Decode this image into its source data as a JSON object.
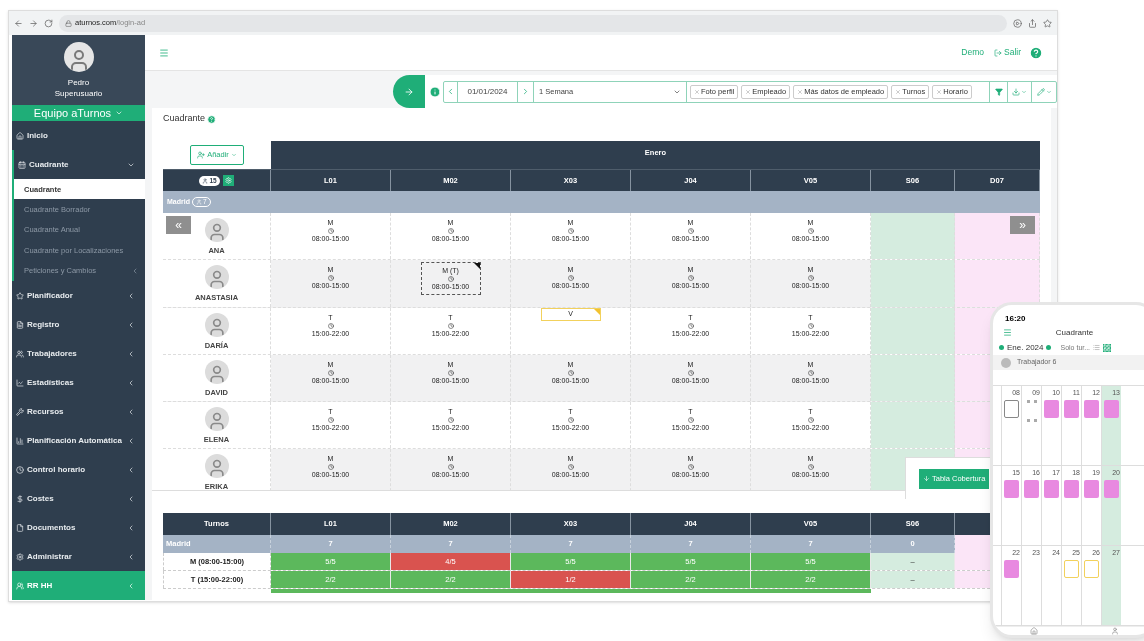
{
  "browser": {
    "host": "aturnos.com",
    "path": "/login-ad"
  },
  "sidebar": {
    "user": {
      "name": "Pedro",
      "role": "Superusuario"
    },
    "team": "Equipo aTurnos",
    "items": [
      {
        "label": "Inicio",
        "selected": false
      },
      {
        "label": "Cuadrante",
        "selected": false,
        "expanded": true,
        "children": [
          {
            "label": "Cuadrante",
            "selected": true
          },
          {
            "label": "Cuadrante Borrador",
            "selected": false
          },
          {
            "label": "Cuadrante Anual",
            "selected": false
          },
          {
            "label": "Cuadrante por Localizaciones",
            "selected": false
          },
          {
            "label": "Peticiones y Cambios",
            "selected": false,
            "expanded": false
          }
        ]
      },
      {
        "label": "Planificador",
        "selected": false,
        "expanded": false
      },
      {
        "label": "Registro",
        "selected": false,
        "expanded": false
      },
      {
        "label": "Trabajadores",
        "selected": false,
        "expanded": false
      },
      {
        "label": "Estadísticas",
        "selected": false,
        "expanded": false
      },
      {
        "label": "Recursos",
        "selected": false,
        "expanded": false
      },
      {
        "label": "Planificación Automática",
        "selected": false,
        "expanded": false
      },
      {
        "label": "Control horario",
        "selected": false,
        "expanded": false
      },
      {
        "label": "Costes",
        "selected": false,
        "expanded": false
      },
      {
        "label": "Documentos",
        "selected": false,
        "expanded": false
      },
      {
        "label": "Administrar",
        "selected": false,
        "expanded": false
      },
      {
        "label": "RR HH",
        "selected": true,
        "expanded": false
      }
    ]
  },
  "topbar": {
    "links": [
      "Demo",
      "Salir"
    ]
  },
  "toolbar": {
    "date": "01/01/2024",
    "range": "1 Semana",
    "chips": [
      "Foto perfil",
      "Empleado",
      "Más datos de empleado",
      "Turnos",
      "Horario"
    ]
  },
  "page_title": "Cuadrante",
  "grid": {
    "add_button": "Añadir",
    "month": "Enero",
    "staff_count": "15",
    "days": [
      {
        "label": "L01",
        "kind": "weekday"
      },
      {
        "label": "M02",
        "kind": "weekday"
      },
      {
        "label": "X03",
        "kind": "weekday"
      },
      {
        "label": "J04",
        "kind": "weekday"
      },
      {
        "label": "V05",
        "kind": "weekday"
      },
      {
        "label": "S06",
        "kind": "saturday"
      },
      {
        "label": "D07",
        "kind": "sunday"
      }
    ],
    "group": {
      "name": "Madrid",
      "count": "7"
    },
    "nav_prev": "«",
    "nav_next": "»",
    "employees": [
      {
        "name": "ANA",
        "shifts": [
          {
            "code": "M",
            "time": "08:00-15:00",
            "kind": "normal"
          },
          {
            "code": "M",
            "time": "08:00-15:00",
            "kind": "normal"
          },
          {
            "code": "M",
            "time": "08:00-15:00",
            "kind": "normal"
          },
          {
            "code": "M",
            "time": "08:00-15:00",
            "kind": "normal"
          },
          {
            "code": "M",
            "time": "08:00-15:00",
            "kind": "normal"
          }
        ]
      },
      {
        "name": "ANASTASIA",
        "shifts": [
          {
            "code": "M",
            "time": "08:00-15:00",
            "kind": "normal"
          },
          {
            "code": "M (T)",
            "time": "08:00-15:00",
            "kind": "changed"
          },
          {
            "code": "M",
            "time": "08:00-15:00",
            "kind": "normal"
          },
          {
            "code": "M",
            "time": "08:00-15:00",
            "kind": "normal"
          },
          {
            "code": "M",
            "time": "08:00-15:00",
            "kind": "normal"
          }
        ]
      },
      {
        "name": "DARÍA",
        "shifts": [
          {
            "code": "T",
            "time": "15:00-22:00",
            "kind": "normal"
          },
          {
            "code": "T",
            "time": "15:00-22:00",
            "kind": "normal"
          },
          {
            "code": "V",
            "kind": "vacation"
          },
          {
            "code": "T",
            "time": "15:00-22:00",
            "kind": "normal"
          },
          {
            "code": "T",
            "time": "15:00-22:00",
            "kind": "normal"
          }
        ]
      },
      {
        "name": "DAVID",
        "shifts": [
          {
            "code": "M",
            "time": "08:00-15:00",
            "kind": "normal"
          },
          {
            "code": "M",
            "time": "08:00-15:00",
            "kind": "normal"
          },
          {
            "code": "M",
            "time": "08:00-15:00",
            "kind": "normal"
          },
          {
            "code": "M",
            "time": "08:00-15:00",
            "kind": "normal"
          },
          {
            "code": "M",
            "time": "08:00-15:00",
            "kind": "normal"
          }
        ]
      },
      {
        "name": "ELENA",
        "shifts": [
          {
            "code": "T",
            "time": "15:00-22:00",
            "kind": "normal"
          },
          {
            "code": "T",
            "time": "15:00-22:00",
            "kind": "normal"
          },
          {
            "code": "T",
            "time": "15:00-22:00",
            "kind": "normal"
          },
          {
            "code": "T",
            "time": "15:00-22:00",
            "kind": "normal"
          },
          {
            "code": "T",
            "time": "15:00-22:00",
            "kind": "normal"
          }
        ]
      },
      {
        "name": "ERIKA",
        "shifts": [
          {
            "code": "M",
            "time": "08:00-15:00",
            "kind": "normal"
          },
          {
            "code": "M",
            "time": "08:00-15:00",
            "kind": "normal"
          },
          {
            "code": "M",
            "time": "08:00-15:00",
            "kind": "normal"
          },
          {
            "code": "M",
            "time": "08:00-15:00",
            "kind": "normal"
          },
          {
            "code": "M",
            "time": "08:00-15:00",
            "kind": "normal"
          }
        ]
      }
    ]
  },
  "coverage": {
    "button": "Tabla Cobertura",
    "title": "Turnos",
    "columns": [
      "L01",
      "M02",
      "X03",
      "J04",
      "V05",
      "S06"
    ],
    "group": {
      "name": "Madrid",
      "counts": [
        "7",
        "7",
        "7",
        "7",
        "7",
        "0"
      ]
    },
    "rows": [
      {
        "label": "M (08:00-15:00)",
        "cells": [
          {
            "value": "5/5",
            "kind": "ok"
          },
          {
            "value": "4/5",
            "kind": "short"
          },
          {
            "value": "5/5",
            "kind": "ok"
          },
          {
            "value": "5/5",
            "kind": "ok"
          },
          {
            "value": "5/5",
            "kind": "ok"
          },
          {
            "value": "–",
            "kind": "none"
          }
        ]
      },
      {
        "label": "T (15:00-22:00)",
        "cells": [
          {
            "value": "2/2",
            "kind": "ok"
          },
          {
            "value": "2/2",
            "kind": "ok"
          },
          {
            "value": "1/2",
            "kind": "short"
          },
          {
            "value": "2/2",
            "kind": "ok"
          },
          {
            "value": "2/2",
            "kind": "ok"
          },
          {
            "value": "–",
            "kind": "none"
          }
        ]
      }
    ]
  },
  "phone": {
    "time": "16:20",
    "title": "Cuadrante",
    "month": "Ene. 2024",
    "filter": "Solo tur...",
    "worker": "Trabajador 6",
    "weeks": [
      [
        {
          "num": "08",
          "kind": "outline",
          "weekend": false
        },
        {
          "num": "09",
          "kind": "plain",
          "weekend": false
        },
        {
          "num": "10",
          "kind": "pink",
          "weekend": false
        },
        {
          "num": "11",
          "kind": "pink",
          "weekend": false
        },
        {
          "num": "12",
          "kind": "pink",
          "weekend": false
        },
        {
          "num": "13",
          "kind": "pink",
          "weekend": true
        }
      ],
      [
        {
          "num": "15",
          "kind": "pink",
          "weekend": false
        },
        {
          "num": "16",
          "kind": "pink",
          "weekend": false
        },
        {
          "num": "17",
          "kind": "pink",
          "weekend": false
        },
        {
          "num": "18",
          "kind": "pink",
          "weekend": false
        },
        {
          "num": "19",
          "kind": "pink",
          "weekend": false
        },
        {
          "num": "20",
          "kind": "pink",
          "weekend": true
        }
      ],
      [
        {
          "num": "22",
          "kind": "pink",
          "weekend": false
        },
        {
          "num": "23",
          "kind": "none",
          "weekend": false
        },
        {
          "num": "24",
          "kind": "none",
          "weekend": false
        },
        {
          "num": "25",
          "kind": "yellow",
          "weekend": false
        },
        {
          "num": "26",
          "kind": "yellow",
          "weekend": false
        },
        {
          "num": "27",
          "kind": "none",
          "weekend": true
        }
      ]
    ]
  }
}
